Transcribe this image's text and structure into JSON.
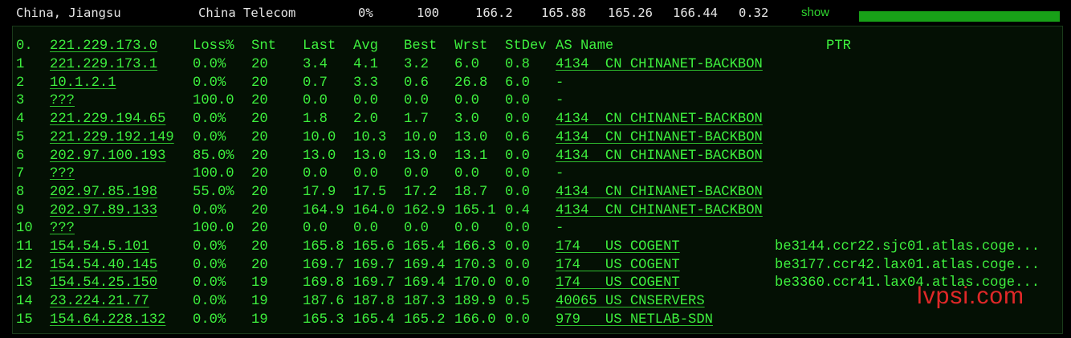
{
  "summary": {
    "location": "China, Jiangsu",
    "isp": "China Telecom",
    "loss": "0%",
    "sent": "100",
    "last": "166.2",
    "avg": "165.88",
    "best": "165.26",
    "worst": "166.44",
    "stdev": "0.32",
    "show_label": "show",
    "bar_fill_fraction": 1.0
  },
  "mtr": {
    "header": {
      "host": "221.229.173.0",
      "hop_index": "0.",
      "loss": "Loss%",
      "snt": "Snt",
      "last": "Last",
      "avg": "Avg",
      "best": "Best",
      "wrst": "Wrst",
      "stdev": "StDev",
      "as_name": "AS Name",
      "ptr": "PTR"
    },
    "rows": [
      {
        "hop": "1",
        "host": "221.229.173.1",
        "loss": "0.0%",
        "snt": "20",
        "last": "3.4",
        "avg": "4.1",
        "best": "3.2",
        "wrst": "6.0",
        "stdev": "0.8",
        "as": "4134  CN CHINANET-BACKBON",
        "ptr": ""
      },
      {
        "hop": "2",
        "host": "10.1.2.1",
        "loss": "0.0%",
        "snt": "20",
        "last": "0.7",
        "avg": "3.3",
        "best": "0.6",
        "wrst": "26.8",
        "stdev": "6.0",
        "as": "-",
        "ptr": ""
      },
      {
        "hop": "3",
        "host": "???",
        "loss": "100.0",
        "snt": "20",
        "last": "0.0",
        "avg": "0.0",
        "best": "0.0",
        "wrst": "0.0",
        "stdev": "0.0",
        "as": "-",
        "ptr": ""
      },
      {
        "hop": "4",
        "host": "221.229.194.65",
        "loss": "0.0%",
        "snt": "20",
        "last": "1.8",
        "avg": "2.0",
        "best": "1.7",
        "wrst": "3.0",
        "stdev": "0.0",
        "as": "4134  CN CHINANET-BACKBON",
        "ptr": ""
      },
      {
        "hop": "5",
        "host": "221.229.192.149",
        "loss": "0.0%",
        "snt": "20",
        "last": "10.0",
        "avg": "10.3",
        "best": "10.0",
        "wrst": "13.0",
        "stdev": "0.6",
        "as": "4134  CN CHINANET-BACKBON",
        "ptr": ""
      },
      {
        "hop": "6",
        "host": "202.97.100.193",
        "loss": "85.0%",
        "snt": "20",
        "last": "13.0",
        "avg": "13.0",
        "best": "13.0",
        "wrst": "13.1",
        "stdev": "0.0",
        "as": "4134  CN CHINANET-BACKBON",
        "ptr": ""
      },
      {
        "hop": "7",
        "host": "???",
        "loss": "100.0",
        "snt": "20",
        "last": "0.0",
        "avg": "0.0",
        "best": "0.0",
        "wrst": "0.0",
        "stdev": "0.0",
        "as": "-",
        "ptr": ""
      },
      {
        "hop": "8",
        "host": "202.97.85.198",
        "loss": "55.0%",
        "snt": "20",
        "last": "17.9",
        "avg": "17.5",
        "best": "17.2",
        "wrst": "18.7",
        "stdev": "0.0",
        "as": "4134  CN CHINANET-BACKBON",
        "ptr": ""
      },
      {
        "hop": "9",
        "host": "202.97.89.133",
        "loss": "0.0%",
        "snt": "20",
        "last": "164.9",
        "avg": "164.0",
        "best": "162.9",
        "wrst": "165.1",
        "stdev": "0.4",
        "as": "4134  CN CHINANET-BACKBON",
        "ptr": ""
      },
      {
        "hop": "10",
        "host": "???",
        "loss": "100.0",
        "snt": "20",
        "last": "0.0",
        "avg": "0.0",
        "best": "0.0",
        "wrst": "0.0",
        "stdev": "0.0",
        "as": "-",
        "ptr": ""
      },
      {
        "hop": "11",
        "host": "154.54.5.101",
        "loss": "0.0%",
        "snt": "20",
        "last": "165.8",
        "avg": "165.6",
        "best": "165.4",
        "wrst": "166.3",
        "stdev": "0.0",
        "as": "174   US COGENT",
        "ptr": "be3144.ccr22.sjc01.atlas.coge..."
      },
      {
        "hop": "12",
        "host": "154.54.40.145",
        "loss": "0.0%",
        "snt": "20",
        "last": "169.7",
        "avg": "169.7",
        "best": "169.4",
        "wrst": "170.3",
        "stdev": "0.0",
        "as": "174   US COGENT",
        "ptr": "be3177.ccr42.lax01.atlas.coge..."
      },
      {
        "hop": "13",
        "host": "154.54.25.150",
        "loss": "0.0%",
        "snt": "19",
        "last": "169.8",
        "avg": "169.7",
        "best": "169.4",
        "wrst": "170.0",
        "stdev": "0.0",
        "as": "174   US COGENT",
        "ptr": "be3360.ccr41.lax04.atlas.coge..."
      },
      {
        "hop": "14",
        "host": "23.224.21.77",
        "loss": "0.0%",
        "snt": "19",
        "last": "187.6",
        "avg": "187.8",
        "best": "187.3",
        "wrst": "189.9",
        "stdev": "0.5",
        "as": "40065 US CNSERVERS",
        "ptr": ""
      },
      {
        "hop": "15",
        "host": "154.64.228.132",
        "loss": "0.0%",
        "snt": "19",
        "last": "165.3",
        "avg": "165.4",
        "best": "165.2",
        "wrst": "166.0",
        "stdev": "0.0",
        "as": "979   US NETLAB-SDN",
        "ptr": ""
      }
    ]
  },
  "watermark": "lvpsi.com",
  "colors": {
    "text_green": "#3ef03e",
    "summary_text": "#e6e6e6",
    "bar": "#18a018",
    "watermark": "#e02828",
    "background": "#000000"
  }
}
